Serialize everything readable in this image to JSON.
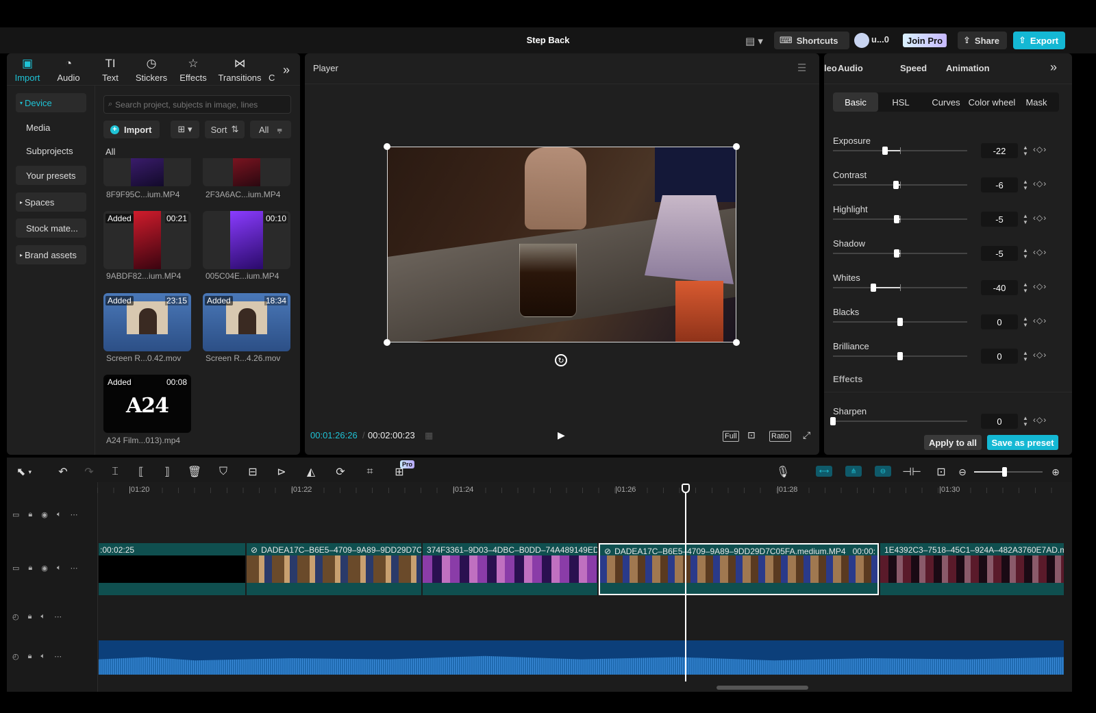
{
  "header": {
    "title": "Step Back",
    "layout_icon": "layout-icon",
    "shortcuts_label": "Shortcuts",
    "user_name": "u...0",
    "join_pro_label": "Join Pro",
    "share_label": "Share",
    "export_label": "Export"
  },
  "left_tabs": [
    {
      "label": "Import",
      "icon": "import-icon"
    },
    {
      "label": "Audio",
      "icon": "audio-icon"
    },
    {
      "label": "Text",
      "icon": "text-icon"
    },
    {
      "label": "Stickers",
      "icon": "stickers-icon"
    },
    {
      "label": "Effects",
      "icon": "effects-icon"
    },
    {
      "label": "Transitions",
      "icon": "transitions-icon"
    },
    {
      "label": "C",
      "icon": "captions-icon"
    }
  ],
  "sidebar": {
    "items": [
      {
        "label": "Device"
      },
      {
        "label": "Media"
      },
      {
        "label": "Subprojects"
      },
      {
        "label": "Your presets"
      },
      {
        "label": "Spaces"
      },
      {
        "label": "Stock mate..."
      },
      {
        "label": "Brand assets"
      }
    ]
  },
  "media": {
    "search_placeholder": "Search project, subjects in image, lines",
    "import_label": "Import",
    "sort_label": "Sort",
    "filter_all_label": "All",
    "section_label": "All",
    "items": [
      {
        "name": "8F9F95C...ium.MP4",
        "added": "",
        "duration": ""
      },
      {
        "name": "2F3A6AC...ium.MP4",
        "added": "",
        "duration": ""
      },
      {
        "name": "9ABDF82...ium.MP4",
        "added": "Added",
        "duration": "00:21"
      },
      {
        "name": "005C04E...ium.MP4",
        "added": "",
        "duration": "00:10"
      },
      {
        "name": "Screen R...0.42.mov",
        "added": "Added",
        "duration": "23:15"
      },
      {
        "name": "Screen R...4.26.mov",
        "added": "Added",
        "duration": "18:34"
      },
      {
        "name": "A24 Film...013).mp4",
        "added": "Added",
        "duration": "00:08"
      }
    ],
    "a24_logo_text": "A24"
  },
  "player": {
    "title": "Player",
    "current_time": "00:01:26:26",
    "total_time": "00:02:00:23",
    "full_label": "Full",
    "ratio_label": "Ratio"
  },
  "right_panel": {
    "tabs": [
      "leo",
      "Audio",
      "Speed",
      "Animation"
    ],
    "subtabs": [
      "Basic",
      "HSL",
      "Curves",
      "Color wheel",
      "Mask"
    ],
    "adjustments": [
      {
        "label": "Exposure",
        "value": "-22",
        "level": -0.22
      },
      {
        "label": "Contrast",
        "value": "-6",
        "level": -0.06
      },
      {
        "label": "Highlight",
        "value": "-5",
        "level": -0.05
      },
      {
        "label": "Shadow",
        "value": "-5",
        "level": -0.05
      },
      {
        "label": "Whites",
        "value": "-40",
        "level": -0.4
      },
      {
        "label": "Blacks",
        "value": "0",
        "level": 0
      },
      {
        "label": "Brilliance",
        "value": "0",
        "level": 0
      }
    ],
    "effects_label": "Effects",
    "sharpen": {
      "label": "Sharpen",
      "value": "0",
      "level": 0
    },
    "apply_all_label": "Apply to all",
    "save_preset_label": "Save as preset"
  },
  "toolbar": {
    "pro_badge": "Pro"
  },
  "timeline": {
    "ruler": [
      "01:20",
      "01:22",
      "01:24",
      "01:26",
      "01:28",
      "01:30"
    ],
    "clips": [
      {
        "label": ":00:02:25"
      },
      {
        "label": "DADEA17C–B6E5–4709–9A89–9DD29D7C"
      },
      {
        "label": "374F3361–9D03–4DBC–B0DD–74A489149ED"
      },
      {
        "label": "DADEA17C–B6E5–4709–9A89–9DD29D7C05FA.medium.MP4"
      },
      {
        "label": "1E4392C3–7518–45C1–924A–482A3760E7AD.m"
      }
    ],
    "selected_clip_duration": "00:00:"
  },
  "colors": {
    "accent": "#1fc3d6",
    "clip_teal": "#0f4f4f",
    "audio_blue": "#0c5a9c",
    "pro_gradient_start": "#c8e8ff"
  }
}
